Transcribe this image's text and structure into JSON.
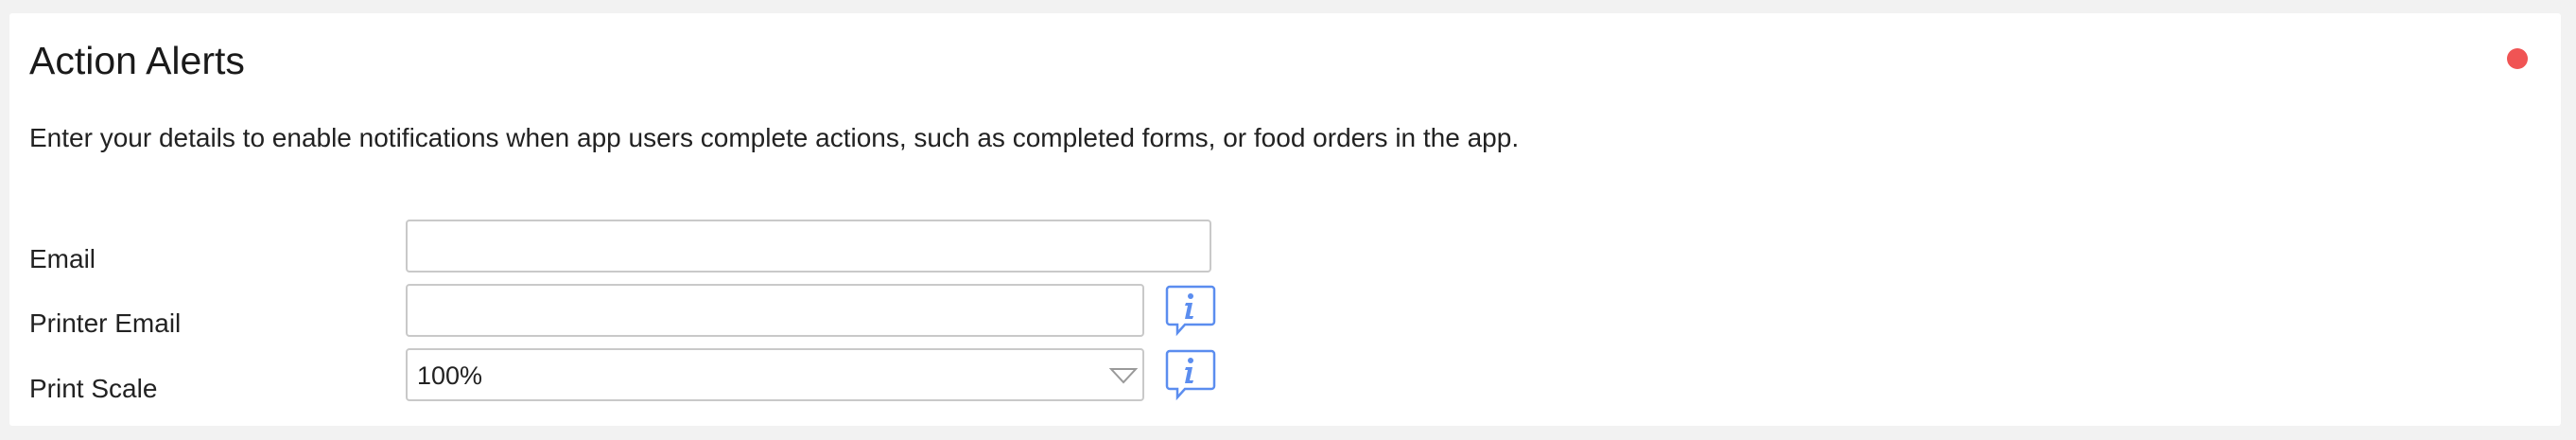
{
  "panel": {
    "title": "Action Alerts",
    "description": "Enter your details to enable notifications when app users complete actions, such as completed forms, or food orders in the app."
  },
  "status": {
    "color": "#f05454"
  },
  "form": {
    "email": {
      "label": "Email",
      "value": "",
      "placeholder": ""
    },
    "printer_email": {
      "label": "Printer Email",
      "value": "",
      "placeholder": "",
      "info_icon": "info-icon"
    },
    "print_scale": {
      "label": "Print Scale",
      "selected": "100%",
      "info_icon": "info-icon"
    }
  },
  "colors": {
    "accent": "#5b8def",
    "border": "#c9c9c9",
    "background": "#f2f2f2",
    "card": "#ffffff"
  }
}
